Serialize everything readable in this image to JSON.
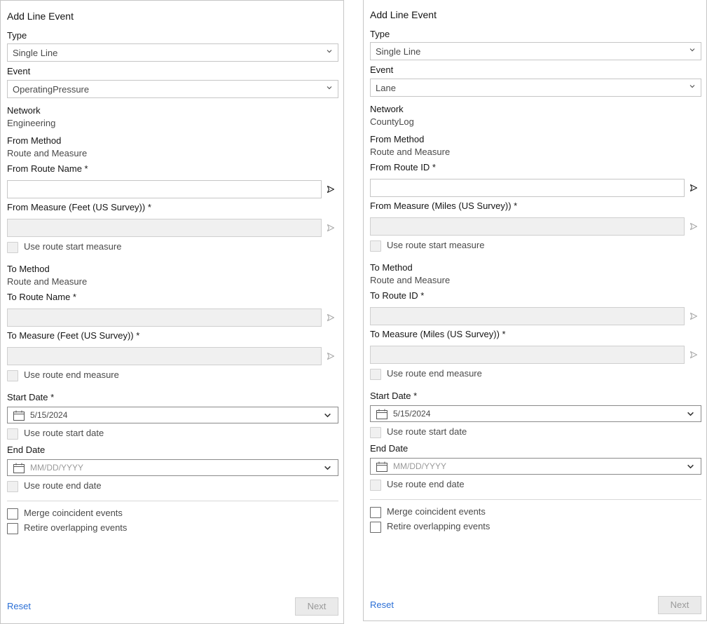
{
  "panels": [
    {
      "title": "Add Line Event",
      "type_label": "Type",
      "type_value": "Single Line",
      "event_label": "Event",
      "event_value": "OperatingPressure",
      "network_label": "Network",
      "network_value": "Engineering",
      "from_method_label": "From Method",
      "from_method_value": "Route and Measure",
      "from_route_label": "From Route Name *",
      "from_route_value": "",
      "from_measure_label": "From Measure (Feet (US Survey)) *",
      "use_route_start_measure": "Use route start measure",
      "to_method_label": "To Method",
      "to_method_value": "Route and Measure",
      "to_route_label": "To Route Name *",
      "to_measure_label": "To Measure (Feet (US Survey)) *",
      "use_route_end_measure": "Use route end measure",
      "start_date_label": "Start Date *",
      "start_date_value": "5/15/2024",
      "use_route_start_date": "Use route start date",
      "end_date_label": "End Date",
      "end_date_placeholder": "MM/DD/YYYY",
      "use_route_end_date": "Use route end date",
      "merge_coincident": "Merge coincident events",
      "retire_overlapping": "Retire overlapping events",
      "reset_label": "Reset",
      "next_label": "Next"
    },
    {
      "title": "Add Line Event",
      "type_label": "Type",
      "type_value": "Single Line",
      "event_label": "Event",
      "event_value": "Lane",
      "network_label": "Network",
      "network_value": "CountyLog",
      "from_method_label": "From Method",
      "from_method_value": "Route and Measure",
      "from_route_label": "From Route ID *",
      "from_route_value": "",
      "from_measure_label": "From Measure (Miles (US Survey)) *",
      "use_route_start_measure": "Use route start measure",
      "to_method_label": "To Method",
      "to_method_value": "Route and Measure",
      "to_route_label": "To Route ID *",
      "to_measure_label": "To Measure (Miles (US Survey)) *",
      "use_route_end_measure": "Use route end measure",
      "start_date_label": "Start Date *",
      "start_date_value": "5/15/2024",
      "use_route_start_date": "Use route start date",
      "end_date_label": "End Date",
      "end_date_placeholder": "MM/DD/YYYY",
      "use_route_end_date": "Use route end date",
      "merge_coincident": "Merge coincident events",
      "retire_overlapping": "Retire overlapping events",
      "reset_label": "Reset",
      "next_label": "Next"
    }
  ],
  "colors": {
    "link": "#2b6fd6",
    "border": "#c6c6c6",
    "disabled_bg": "#f0f0f0"
  }
}
